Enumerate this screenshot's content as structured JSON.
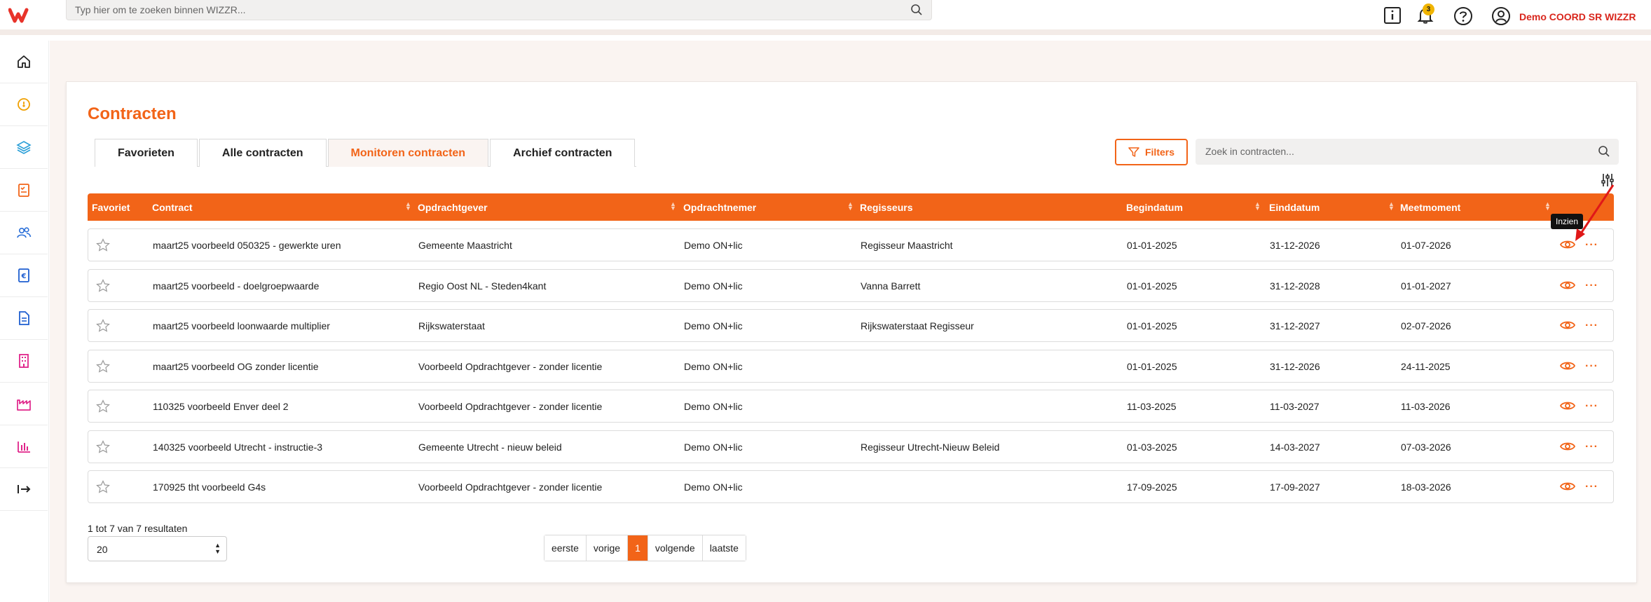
{
  "search_top": {
    "placeholder": "Typ hier om te zoeken binnen WIZZR..."
  },
  "header": {
    "user": "Demo COORD SR WIZZR",
    "notification_count": "3"
  },
  "page": {
    "title": "Contracten"
  },
  "tabs": [
    {
      "label": "Favorieten",
      "active": false
    },
    {
      "label": "Alle contracten",
      "active": false
    },
    {
      "label": "Monitoren contracten",
      "active": true
    },
    {
      "label": "Archief contracten",
      "active": false
    }
  ],
  "toolbar": {
    "filters_label": "Filters",
    "search_placeholder": "Zoek in contracten..."
  },
  "table": {
    "columns": [
      "Favoriet",
      "Contract",
      "Opdrachtgever",
      "Opdrachtnemer",
      "Regisseurs",
      "Begindatum",
      "Einddatum",
      "Meetmoment"
    ],
    "rows": [
      [
        "maart25 voorbeeld 050325 - gewerkte uren",
        "Gemeente Maastricht",
        "Demo ON+lic",
        "Regisseur Maastricht",
        "01-01-2025",
        "31-12-2026",
        "01-07-2026"
      ],
      [
        "maart25 voorbeeld - doelgroepwaarde",
        "Regio Oost NL - Steden4kant",
        "Demo ON+lic",
        "Vanna Barrett",
        "01-01-2025",
        "31-12-2028",
        "01-01-2027"
      ],
      [
        "maart25 voorbeeld loonwaarde multiplier",
        "Rijkswaterstaat",
        "Demo ON+lic",
        "Rijkswaterstaat Regisseur",
        "01-01-2025",
        "31-12-2027",
        "02-07-2026"
      ],
      [
        "maart25 voorbeeld OG zonder licentie",
        "Voorbeeld Opdrachtgever - zonder licentie",
        "Demo ON+lic",
        "",
        "01-01-2025",
        "31-12-2026",
        "24-11-2025"
      ],
      [
        "110325 voorbeeld Enver deel 2",
        "Voorbeeld Opdrachtgever - zonder licentie",
        "Demo ON+lic",
        "",
        "11-03-2025",
        "11-03-2027",
        "11-03-2026"
      ],
      [
        "140325 voorbeeld Utrecht - instructie-3",
        "Gemeente Utrecht - nieuw beleid",
        "Demo ON+lic",
        "Regisseur Utrecht-Nieuw Beleid",
        "01-03-2025",
        "14-03-2027",
        "07-03-2026"
      ],
      [
        "170925 tht voorbeeld G4s",
        "Voorbeeld Opdrachtgever - zonder licentie",
        "Demo ON+lic",
        "",
        "17-09-2025",
        "17-09-2027",
        "18-03-2026"
      ]
    ]
  },
  "tooltip": "Inzien",
  "footer": {
    "results": "1 tot 7 van 7 resultaten",
    "page_size": "20"
  },
  "pagination": [
    "eerste",
    "vorige",
    "1",
    "volgende",
    "laatste"
  ],
  "colors": {
    "accent": "#f26418",
    "user": "#d9261c"
  }
}
